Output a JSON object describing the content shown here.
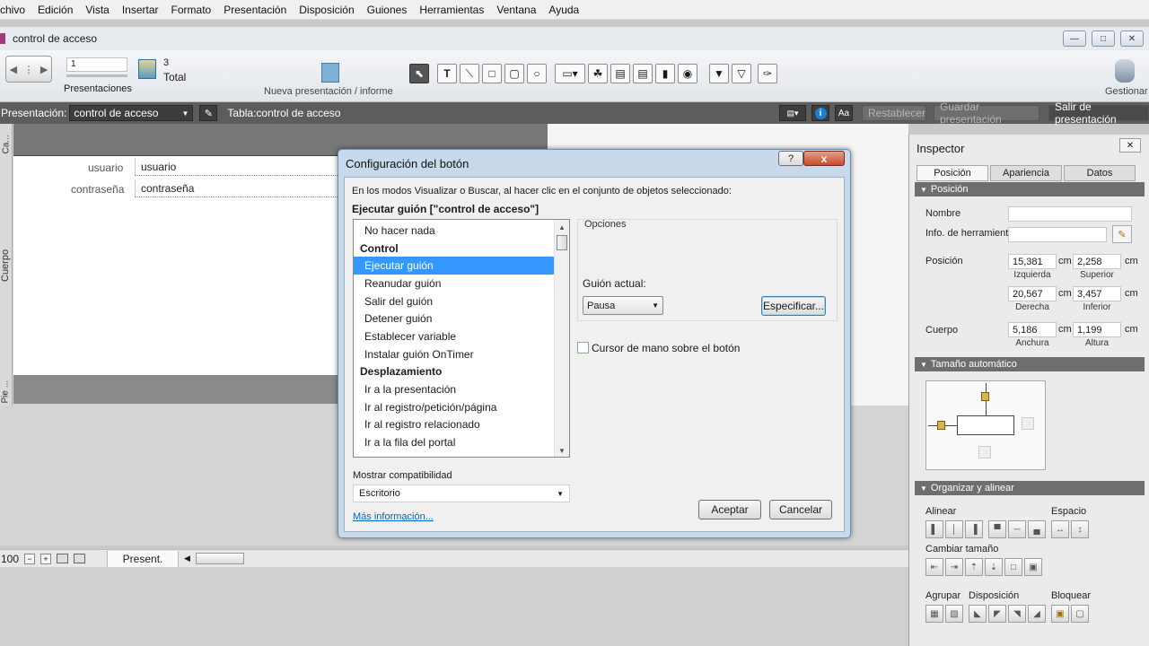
{
  "menu": [
    "chivo",
    "Edición",
    "Vista",
    "Insertar",
    "Formato",
    "Presentación",
    "Disposición",
    "Guiones",
    "Herramientas",
    "Ventana",
    "Ayuda"
  ],
  "window": {
    "title": "control de acceso"
  },
  "toolbar": {
    "record_value": "1",
    "presentations_label": "Presentaciones",
    "total_count": "3",
    "total_label": "Total",
    "new_layout_label": "Nueva presentación / informe",
    "manage_label": "Gestionar"
  },
  "layoutbar": {
    "presentation_label": "Presentación:",
    "presentation_value": "control de acceso",
    "table_label": "Tabla:",
    "table_value": "control de acceso",
    "aa_label": "Aa",
    "revert_label": "Restablecer",
    "save_label": "Guardar presentación",
    "exit_label": "Salir de presentación"
  },
  "canvas": {
    "ca_label": "Ca...",
    "body_label": "Cuerpo",
    "pie_label": "Pie ...",
    "fields": [
      {
        "label": "usuario",
        "value": "usuario"
      },
      {
        "label": "contraseña",
        "value": "contraseña"
      }
    ]
  },
  "statusbar": {
    "zoom": "100",
    "mode": "Present."
  },
  "dialog": {
    "title": "Configuración del botón",
    "description": "En los modos Visualizar o Buscar, al hacer clic en el conjunto de objetos seleccionado:",
    "action_heading": "Ejecutar guión [\"control de acceso\"]",
    "options_label": "Opciones",
    "actions": [
      {
        "label": "No hacer nada",
        "type": "item"
      },
      {
        "label": "Control",
        "type": "header"
      },
      {
        "label": "Ejecutar guión",
        "type": "selected"
      },
      {
        "label": "Reanudar guión",
        "type": "item"
      },
      {
        "label": "Salir del guión",
        "type": "item"
      },
      {
        "label": "Detener guión",
        "type": "item"
      },
      {
        "label": "Establecer variable",
        "type": "item"
      },
      {
        "label": "Instalar guión OnTimer",
        "type": "item"
      },
      {
        "label": "Desplazamiento",
        "type": "header"
      },
      {
        "label": "Ir a la presentación",
        "type": "item"
      },
      {
        "label": "Ir al registro/petición/página",
        "type": "item"
      },
      {
        "label": "Ir al registro relacionado",
        "type": "item"
      },
      {
        "label": "Ir a la fila del portal",
        "type": "item"
      }
    ],
    "current_script_label": "Guión actual:",
    "current_script_value": "Pausa",
    "specify_button": "Especificar...",
    "hand_cursor_label": "Cursor de mano sobre el botón",
    "compat_label": "Mostrar compatibilidad",
    "compat_value": "Escritorio",
    "more_info_link": "Más información...",
    "ok_button": "Aceptar",
    "cancel_button": "Cancelar",
    "help_button": "?",
    "close_button": "x"
  },
  "inspector": {
    "title": "Inspector",
    "tabs": [
      "Posición",
      "Apariencia",
      "Datos"
    ],
    "section_position": "Posición",
    "name_label": "Nombre",
    "tooltip_label": "Info. de herramientas",
    "position_label": "Posición",
    "body_label": "Cuerpo",
    "unit": "cm",
    "left": {
      "value": "15,381",
      "caption": "Izquierda"
    },
    "top": {
      "value": "2,258",
      "caption": "Superior"
    },
    "right": {
      "value": "20,567",
      "caption": "Derecha"
    },
    "bottom": {
      "value": "3,457",
      "caption": "Inferior"
    },
    "width": {
      "value": "5,186",
      "caption": "Anchura"
    },
    "height": {
      "value": "1,199",
      "caption": "Altura"
    },
    "section_autosize": "Tamaño automático",
    "section_arrange": "Organizar y alinear",
    "align_label": "Alinear",
    "space_label": "Espacio",
    "resize_label": "Cambiar tamaño",
    "group_label": "Agrupar",
    "arrange_label": "Disposición",
    "lock_label": "Bloquear"
  }
}
